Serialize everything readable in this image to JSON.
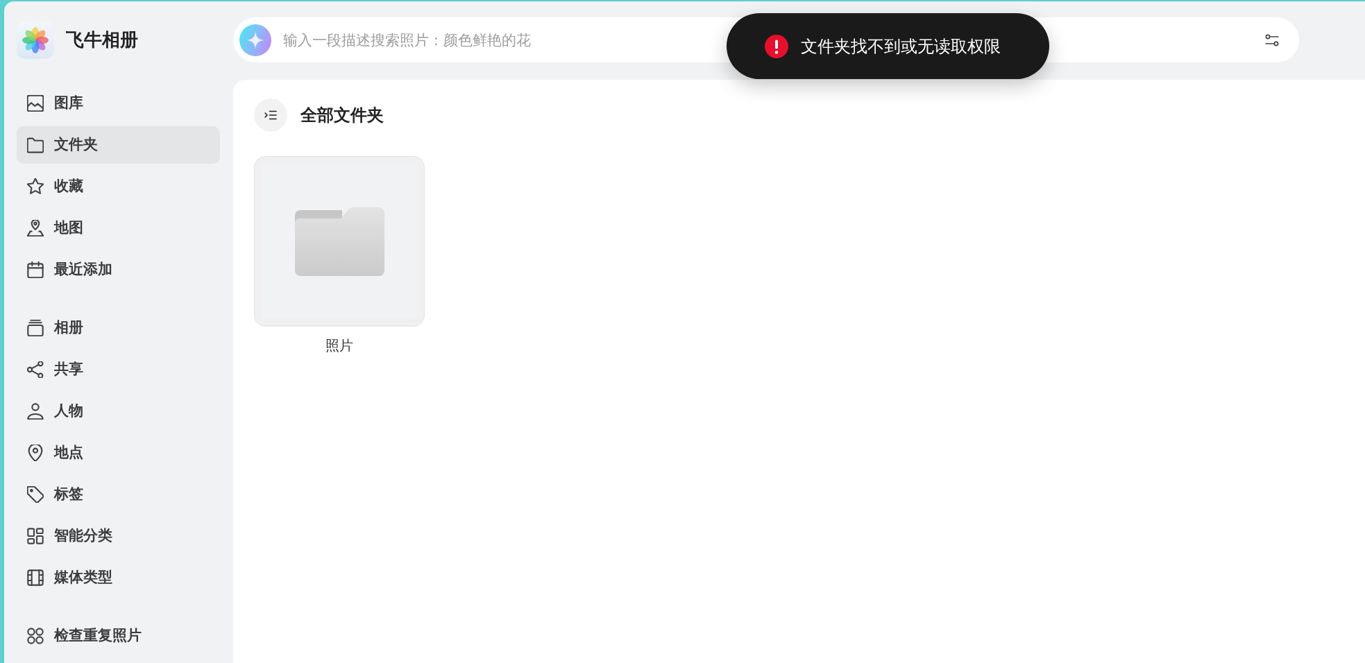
{
  "app": {
    "title": "飞牛相册"
  },
  "sidebar": {
    "sections": [
      {
        "items": [
          {
            "kind": "gallery",
            "label": "图库",
            "selected": false
          },
          {
            "kind": "folder",
            "label": "文件夹",
            "selected": true
          },
          {
            "kind": "favorites",
            "label": "收藏",
            "selected": false
          },
          {
            "kind": "map",
            "label": "地图",
            "selected": false
          },
          {
            "kind": "recent",
            "label": "最近添加",
            "selected": false
          }
        ]
      },
      {
        "items": [
          {
            "kind": "albums",
            "label": "相册",
            "selected": false
          },
          {
            "kind": "shared",
            "label": "共享",
            "selected": false
          },
          {
            "kind": "people",
            "label": "人物",
            "selected": false
          },
          {
            "kind": "places",
            "label": "地点",
            "selected": false
          },
          {
            "kind": "tags",
            "label": "标签",
            "selected": false
          },
          {
            "kind": "smart",
            "label": "智能分类",
            "selected": false
          },
          {
            "kind": "media",
            "label": "媒体类型",
            "selected": false
          }
        ]
      },
      {
        "items": [
          {
            "kind": "duplicates",
            "label": "检查重复照片",
            "selected": false
          }
        ]
      }
    ]
  },
  "search": {
    "placeholder": "输入一段描述搜索照片：颜色鲜艳的花"
  },
  "content": {
    "title": "全部文件夹",
    "folders": [
      {
        "name": "照片"
      }
    ]
  },
  "toast": {
    "kind": "error",
    "message": "文件夹找不到或无读取权限"
  }
}
